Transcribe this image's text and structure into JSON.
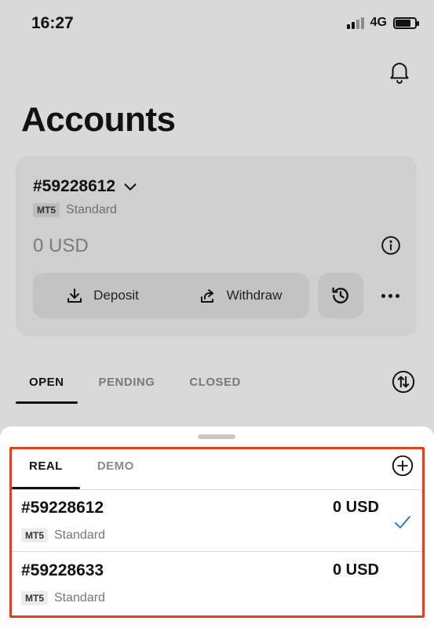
{
  "status_bar": {
    "time": "16:27",
    "network": "4G"
  },
  "page": {
    "title": "Accounts"
  },
  "account_card": {
    "number": "#59228612",
    "platform_badge": "MT5",
    "type": "Standard",
    "balance": "0 USD",
    "deposit_label": "Deposit",
    "withdraw_label": "Withdraw"
  },
  "order_tabs": [
    {
      "label": "OPEN",
      "active": true
    },
    {
      "label": "PENDING",
      "active": false
    },
    {
      "label": "CLOSED",
      "active": false
    }
  ],
  "account_sheet": {
    "tabs": [
      {
        "label": "REAL",
        "active": true
      },
      {
        "label": "DEMO",
        "active": false
      }
    ],
    "accounts": [
      {
        "number": "#59228612",
        "balance": "0 USD",
        "platform_badge": "MT5",
        "type": "Standard",
        "selected": true
      },
      {
        "number": "#59228633",
        "balance": "0 USD",
        "platform_badge": "MT5",
        "type": "Standard",
        "selected": false
      }
    ]
  },
  "colors": {
    "highlight": "#e0401f",
    "check": "#2f6fb5",
    "background": "#d9d9d9",
    "sheet": "#ffffff"
  },
  "icons": [
    "signal-icon",
    "battery-icon",
    "bell-icon",
    "chevron-down-icon",
    "info-icon",
    "download-icon",
    "share-out-icon",
    "history-icon",
    "more-icon",
    "sort-icon",
    "plus-circle-icon",
    "checkmark-icon"
  ]
}
